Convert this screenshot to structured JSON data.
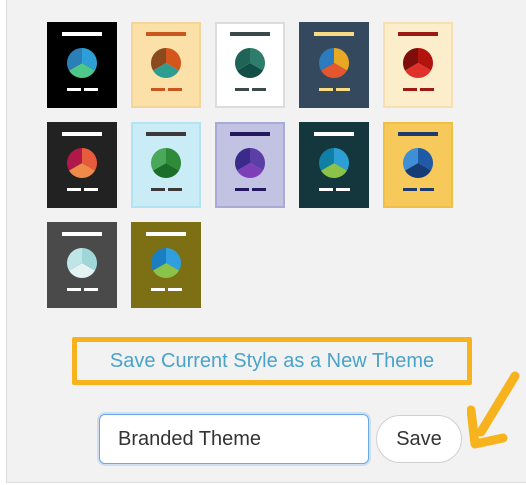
{
  "themes": [
    {
      "bg": "#000000",
      "border": "#000000",
      "bar": "#ffffff",
      "lines": "#ffffff",
      "pie": [
        "#2e9fd6",
        "#4ec78a",
        "#2a7fb8"
      ]
    },
    {
      "bg": "#fbe0a8",
      "border": "#f5d49a",
      "bar": "#c9581e",
      "lines": "#c9581e",
      "pie": [
        "#d4561c",
        "#2f9c90",
        "#8a4a1c"
      ]
    },
    {
      "bg": "#ffffff",
      "border": "#dcdcdc",
      "bar": "#3a4a4a",
      "lines": "#3a4a4a",
      "pie": [
        "#2e7d6c",
        "#104e46",
        "#1f6456"
      ]
    },
    {
      "bg": "#34495e",
      "border": "#34495e",
      "bar": "#f7dc83",
      "lines": "#f7dc83",
      "pie": [
        "#e9a823",
        "#e4572e",
        "#2b7bbf"
      ]
    },
    {
      "bg": "#fdeecb",
      "border": "#f7dfb4",
      "bar": "#9d1a14",
      "lines": "#9d1a14",
      "pie": [
        "#b1130f",
        "#e0322a",
        "#7e0e0a"
      ]
    },
    {
      "bg": "#222222",
      "border": "#222222",
      "bar": "#ffffff",
      "lines": "#ffffff",
      "pie": [
        "#e75a3c",
        "#f08a4a",
        "#b0184a"
      ]
    },
    {
      "bg": "#c9ecf7",
      "border": "#b3e2f2",
      "bar": "#3a3a3a",
      "lines": "#3a3a3a",
      "pie": [
        "#2e8b3a",
        "#1a6e2a",
        "#4aa85a"
      ]
    },
    {
      "bg": "#c2c2e2",
      "border": "#aaaad6",
      "bar": "#24185f",
      "lines": "#24185f",
      "pie": [
        "#5b3fa6",
        "#7d3fb8",
        "#3a2a8a"
      ]
    },
    {
      "bg": "#14363d",
      "border": "#14363d",
      "bar": "#ffffff",
      "lines": "#ffffff",
      "pie": [
        "#2e9fd6",
        "#8bc34a",
        "#0f7fa8"
      ]
    },
    {
      "bg": "#f6c95a",
      "border": "#f2bf45",
      "bar": "#1e3b6e",
      "lines": "#1e3b6e",
      "pie": [
        "#1f5aa8",
        "#163c78",
        "#3e8fd6"
      ]
    },
    {
      "bg": "#4a4a4a",
      "border": "#4a4a4a",
      "bar": "#ffffff",
      "lines": "#ffffff",
      "pie": [
        "#9fd7d9",
        "#e3f3f3",
        "#bfe5e6"
      ]
    },
    {
      "bg": "#7c6f14",
      "border": "#7c6f14",
      "bar": "#ffffff",
      "lines": "#ffffff",
      "pie": [
        "#2f9fe0",
        "#8bc34a",
        "#1a7fc0"
      ]
    }
  ],
  "save_theme_link": "Save Current Style as a New Theme",
  "theme_name_input": {
    "value": "Branded Theme"
  },
  "save_button_label": "Save",
  "colors": {
    "highlight": "#f6b31d",
    "link": "#4aa3c8"
  }
}
